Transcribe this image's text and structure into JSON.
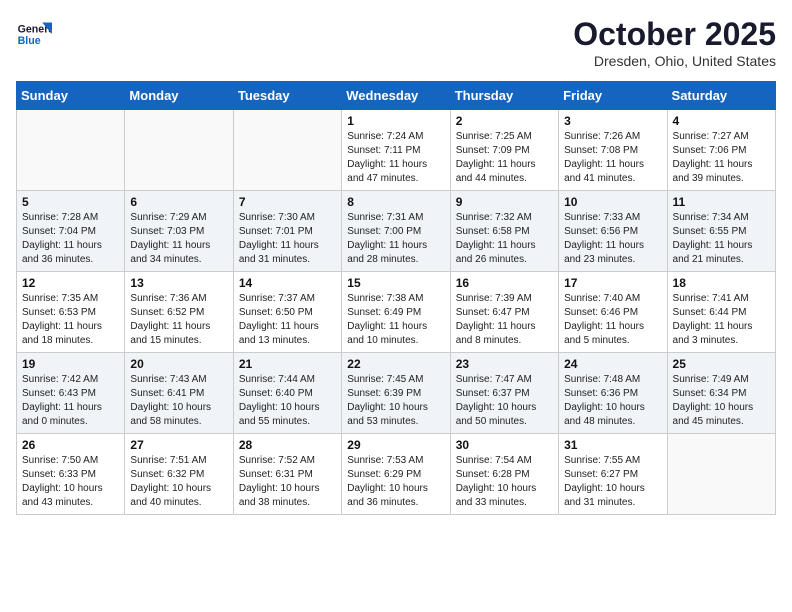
{
  "header": {
    "logo_general": "General",
    "logo_blue": "Blue",
    "month": "October 2025",
    "location": "Dresden, Ohio, United States"
  },
  "days_of_week": [
    "Sunday",
    "Monday",
    "Tuesday",
    "Wednesday",
    "Thursday",
    "Friday",
    "Saturday"
  ],
  "weeks": [
    [
      {
        "day": "",
        "info": ""
      },
      {
        "day": "",
        "info": ""
      },
      {
        "day": "",
        "info": ""
      },
      {
        "day": "1",
        "info": "Sunrise: 7:24 AM\nSunset: 7:11 PM\nDaylight: 11 hours\nand 47 minutes."
      },
      {
        "day": "2",
        "info": "Sunrise: 7:25 AM\nSunset: 7:09 PM\nDaylight: 11 hours\nand 44 minutes."
      },
      {
        "day": "3",
        "info": "Sunrise: 7:26 AM\nSunset: 7:08 PM\nDaylight: 11 hours\nand 41 minutes."
      },
      {
        "day": "4",
        "info": "Sunrise: 7:27 AM\nSunset: 7:06 PM\nDaylight: 11 hours\nand 39 minutes."
      }
    ],
    [
      {
        "day": "5",
        "info": "Sunrise: 7:28 AM\nSunset: 7:04 PM\nDaylight: 11 hours\nand 36 minutes."
      },
      {
        "day": "6",
        "info": "Sunrise: 7:29 AM\nSunset: 7:03 PM\nDaylight: 11 hours\nand 34 minutes."
      },
      {
        "day": "7",
        "info": "Sunrise: 7:30 AM\nSunset: 7:01 PM\nDaylight: 11 hours\nand 31 minutes."
      },
      {
        "day": "8",
        "info": "Sunrise: 7:31 AM\nSunset: 7:00 PM\nDaylight: 11 hours\nand 28 minutes."
      },
      {
        "day": "9",
        "info": "Sunrise: 7:32 AM\nSunset: 6:58 PM\nDaylight: 11 hours\nand 26 minutes."
      },
      {
        "day": "10",
        "info": "Sunrise: 7:33 AM\nSunset: 6:56 PM\nDaylight: 11 hours\nand 23 minutes."
      },
      {
        "day": "11",
        "info": "Sunrise: 7:34 AM\nSunset: 6:55 PM\nDaylight: 11 hours\nand 21 minutes."
      }
    ],
    [
      {
        "day": "12",
        "info": "Sunrise: 7:35 AM\nSunset: 6:53 PM\nDaylight: 11 hours\nand 18 minutes."
      },
      {
        "day": "13",
        "info": "Sunrise: 7:36 AM\nSunset: 6:52 PM\nDaylight: 11 hours\nand 15 minutes."
      },
      {
        "day": "14",
        "info": "Sunrise: 7:37 AM\nSunset: 6:50 PM\nDaylight: 11 hours\nand 13 minutes."
      },
      {
        "day": "15",
        "info": "Sunrise: 7:38 AM\nSunset: 6:49 PM\nDaylight: 11 hours\nand 10 minutes."
      },
      {
        "day": "16",
        "info": "Sunrise: 7:39 AM\nSunset: 6:47 PM\nDaylight: 11 hours\nand 8 minutes."
      },
      {
        "day": "17",
        "info": "Sunrise: 7:40 AM\nSunset: 6:46 PM\nDaylight: 11 hours\nand 5 minutes."
      },
      {
        "day": "18",
        "info": "Sunrise: 7:41 AM\nSunset: 6:44 PM\nDaylight: 11 hours\nand 3 minutes."
      }
    ],
    [
      {
        "day": "19",
        "info": "Sunrise: 7:42 AM\nSunset: 6:43 PM\nDaylight: 11 hours\nand 0 minutes."
      },
      {
        "day": "20",
        "info": "Sunrise: 7:43 AM\nSunset: 6:41 PM\nDaylight: 10 hours\nand 58 minutes."
      },
      {
        "day": "21",
        "info": "Sunrise: 7:44 AM\nSunset: 6:40 PM\nDaylight: 10 hours\nand 55 minutes."
      },
      {
        "day": "22",
        "info": "Sunrise: 7:45 AM\nSunset: 6:39 PM\nDaylight: 10 hours\nand 53 minutes."
      },
      {
        "day": "23",
        "info": "Sunrise: 7:47 AM\nSunset: 6:37 PM\nDaylight: 10 hours\nand 50 minutes."
      },
      {
        "day": "24",
        "info": "Sunrise: 7:48 AM\nSunset: 6:36 PM\nDaylight: 10 hours\nand 48 minutes."
      },
      {
        "day": "25",
        "info": "Sunrise: 7:49 AM\nSunset: 6:34 PM\nDaylight: 10 hours\nand 45 minutes."
      }
    ],
    [
      {
        "day": "26",
        "info": "Sunrise: 7:50 AM\nSunset: 6:33 PM\nDaylight: 10 hours\nand 43 minutes."
      },
      {
        "day": "27",
        "info": "Sunrise: 7:51 AM\nSunset: 6:32 PM\nDaylight: 10 hours\nand 40 minutes."
      },
      {
        "day": "28",
        "info": "Sunrise: 7:52 AM\nSunset: 6:31 PM\nDaylight: 10 hours\nand 38 minutes."
      },
      {
        "day": "29",
        "info": "Sunrise: 7:53 AM\nSunset: 6:29 PM\nDaylight: 10 hours\nand 36 minutes."
      },
      {
        "day": "30",
        "info": "Sunrise: 7:54 AM\nSunset: 6:28 PM\nDaylight: 10 hours\nand 33 minutes."
      },
      {
        "day": "31",
        "info": "Sunrise: 7:55 AM\nSunset: 6:27 PM\nDaylight: 10 hours\nand 31 minutes."
      },
      {
        "day": "",
        "info": ""
      }
    ]
  ]
}
